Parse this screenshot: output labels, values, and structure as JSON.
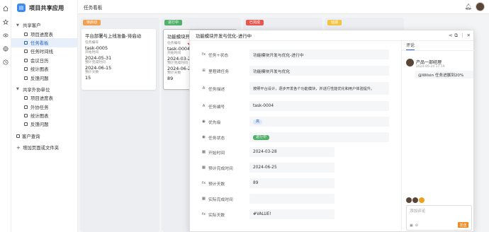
{
  "app": {
    "title": "项目共享应用",
    "logo_glyph": "▤"
  },
  "rail_icons": [
    "home-icon",
    "star-icon",
    "eye-icon",
    "globe-icon",
    "history-icon"
  ],
  "sidebar": {
    "groups": [
      {
        "label": "共享客户",
        "items": [
          "项目进度表",
          "任务看板",
          "任务时间线",
          "会议日历",
          "统计图表",
          "反馈问题"
        ]
      },
      {
        "label": "共享外协单位",
        "items": [
          "项目进度表",
          "外协任务",
          "统计图表",
          "反馈问题"
        ]
      }
    ],
    "customer_query": "客户查询",
    "add_page": "增加页面或文件夹"
  },
  "topbar": {
    "title": "任务看板"
  },
  "columns": [
    {
      "tag": "待启动",
      "color": "#f0a050"
    },
    {
      "tag": "进行中",
      "color": "#52b06a"
    },
    {
      "tag": "已完成",
      "color": "#e8574f"
    },
    {
      "tag": "延期",
      "color": "#f5c342"
    }
  ],
  "cards": {
    "c1": {
      "title": "平台部署与上线准备-待启动",
      "l1": "任务编号",
      "v1": "task-0005",
      "l2": "开始时间",
      "v2": "2024-05-31",
      "l3": "预计完成时间",
      "v3": "2024-06-15",
      "l4": "预计天数",
      "v4": "15"
    },
    "c2": {
      "title": "功能模块开发",
      "l1": "任务编号",
      "v1": "task-0004",
      "l2": "开始时间",
      "v2": "2024-03-28",
      "l3": "预计完成时间",
      "v3": "2024-06-25",
      "l4": "预计天数",
      "v4": "89"
    }
  },
  "modal": {
    "title": "功能模块开发与优化-进行中",
    "fields": [
      {
        "icon": "fx",
        "label": "任务+状态",
        "value": "功能模块开发与优化-进行中"
      },
      {
        "icon": "⊞",
        "label": "里程碑任务",
        "value": "功能模块开发与优化"
      },
      {
        "icon": "A",
        "label": "任务描述",
        "value": "按照平台设计，逐步开发各个功能模块，并进行性能优化和用户体验提升。"
      },
      {
        "icon": "A",
        "label": "任务编号",
        "value": "task-0004"
      },
      {
        "icon": "◉",
        "label": "优先级",
        "value": "高"
      },
      {
        "icon": "◉",
        "label": "任务状态",
        "value": "进行中"
      },
      {
        "icon": "▦",
        "label": "开始时间",
        "value": "2024-03-28"
      },
      {
        "icon": "▦",
        "label": "预计完成时间",
        "value": "2024-06-25"
      },
      {
        "icon": "fx",
        "label": "预计天数",
        "value": "89"
      },
      {
        "icon": "▦",
        "label": "实际完成时间",
        "value": ""
      },
      {
        "icon": "fx",
        "label": "实际天数",
        "value": "#VALUE!"
      }
    ],
    "priority_color": "#dce8f8",
    "status_color": "#52b06a"
  },
  "comments": {
    "tab": "评论",
    "author": "产品一部经理",
    "time": "2024-05-24 17:19",
    "text": "@Wilsin 任务进展到20%",
    "placeholder": "添加评论",
    "send_label": "发送"
  }
}
